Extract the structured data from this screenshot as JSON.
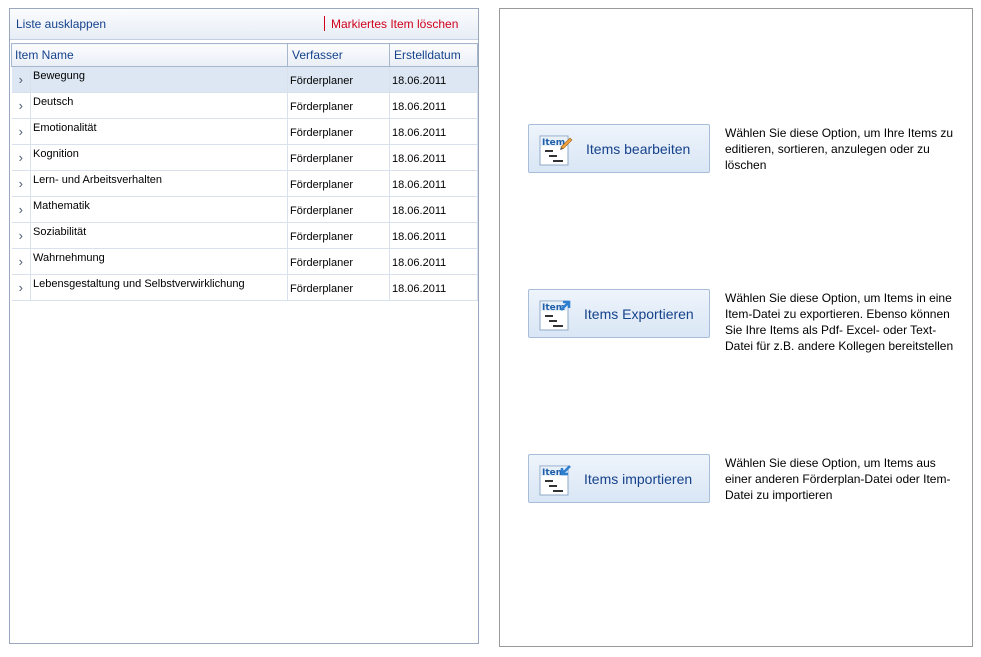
{
  "toolbar": {
    "expand_label": "Liste ausklappen",
    "delete_label": "Markiertes Item löschen"
  },
  "grid": {
    "columns": [
      "Item Name",
      "Verfasser",
      "Erstelldatum"
    ],
    "rows": [
      {
        "name": "Bewegung",
        "author": "Förderplaner",
        "date": "18.06.2011"
      },
      {
        "name": "Deutsch",
        "author": "Förderplaner",
        "date": "18.06.2011"
      },
      {
        "name": "Emotionalität",
        "author": "Förderplaner",
        "date": "18.06.2011"
      },
      {
        "name": "Kognition",
        "author": "Förderplaner",
        "date": "18.06.2011"
      },
      {
        "name": "Lern- und Arbeitsverhalten",
        "author": "Förderplaner",
        "date": "18.06.2011"
      },
      {
        "name": "Mathematik",
        "author": "Förderplaner",
        "date": "18.06.2011"
      },
      {
        "name": "Soziabilität",
        "author": "Förderplaner",
        "date": "18.06.2011"
      },
      {
        "name": "Wahrnehmung",
        "author": "Förderplaner",
        "date": "18.06.2011"
      },
      {
        "name": "Lebensgestaltung und Selbstverwirklichung",
        "author": "Förderplaner",
        "date": "18.06.2011"
      }
    ],
    "expand_glyph": "›",
    "selected_row": 0
  },
  "actions": {
    "edit": {
      "label": "Items bearbeiten",
      "icon_text": "Item",
      "icon": "item-edit-icon",
      "desc": "Wählen Sie diese Option, um Ihre Items zu editieren, sortieren, anzulegen oder zu löschen"
    },
    "export": {
      "label": "Items Exportieren",
      "icon_text": "Item",
      "icon": "item-export-icon",
      "desc": "Wählen Sie diese Option, um Items in eine Item-Datei zu exportieren. Ebenso können Sie Ihre Items als Pdf- Excel- oder Text-Datei für z.B. andere Kollegen bereitstellen"
    },
    "import": {
      "label": "Items importieren",
      "icon_text": "Item",
      "icon": "item-import-icon",
      "desc": "Wählen Sie diese Option, um Items aus einer anderen Förderplan-Datei oder Item-Datei zu importieren"
    }
  },
  "colors": {
    "header_text": "#15428b",
    "delete_text": "#d0001b",
    "selected_row": "#dde7f4"
  }
}
